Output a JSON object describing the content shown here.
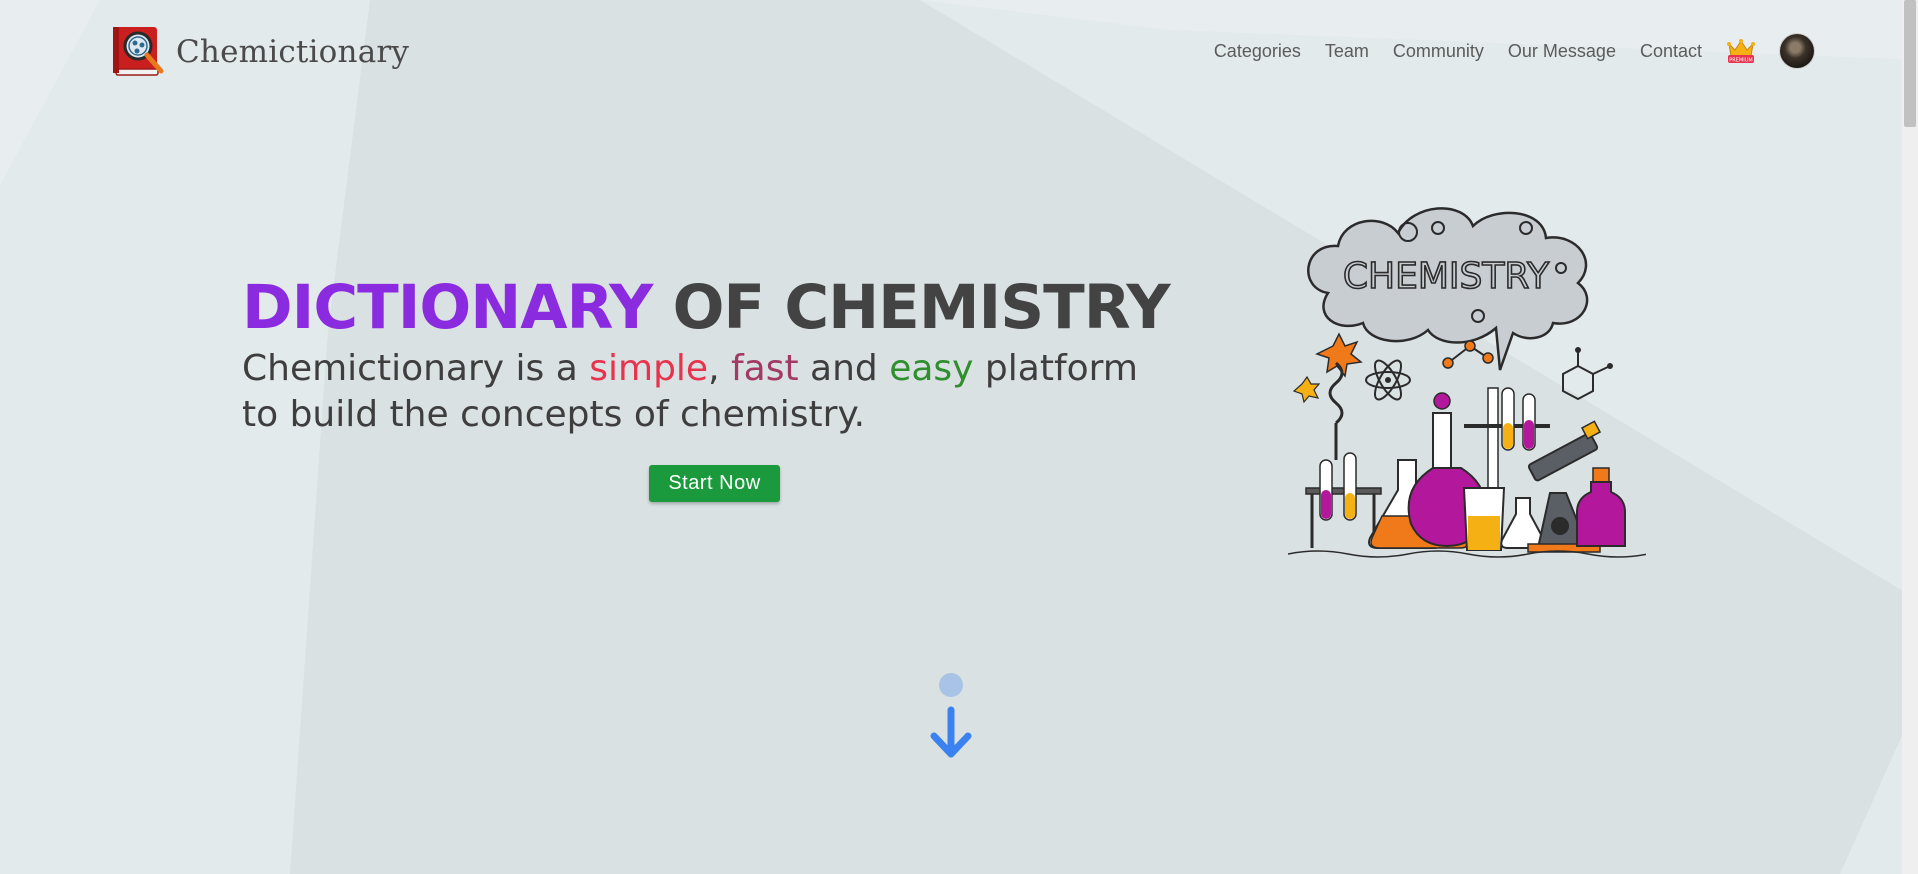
{
  "brand": {
    "name": "Chemictionary",
    "logo_icon": "book-magnifier-icon"
  },
  "nav": {
    "items": [
      {
        "label": "Categories"
      },
      {
        "label": "Team"
      },
      {
        "label": "Community"
      },
      {
        "label": "Our Message"
      },
      {
        "label": "Contact"
      }
    ],
    "premium_icon": "crown-icon",
    "premium_badge_text": "PREMIUM"
  },
  "hero": {
    "title_part1": "DICTIONARY",
    "title_part2": " OF CHEMISTRY",
    "subtitle": {
      "before": "Chemictionary is a ",
      "word1": "simple",
      "sep1": ", ",
      "word2": "fast",
      "middle": " and ",
      "word3": "easy",
      "after": " platform to build the concepts of chemistry."
    },
    "cta_label": "Start Now",
    "illustration_text": "CHEMISTRY"
  },
  "colors": {
    "title_accent": "#8b2be0",
    "simple": "#e8334f",
    "fast": "#a23a66",
    "easy": "#2f8f2f",
    "cta": "#1a9a3c",
    "scroll_arrow": "#3b82f0"
  },
  "scroll": {
    "icon": "arrow-down-icon"
  }
}
